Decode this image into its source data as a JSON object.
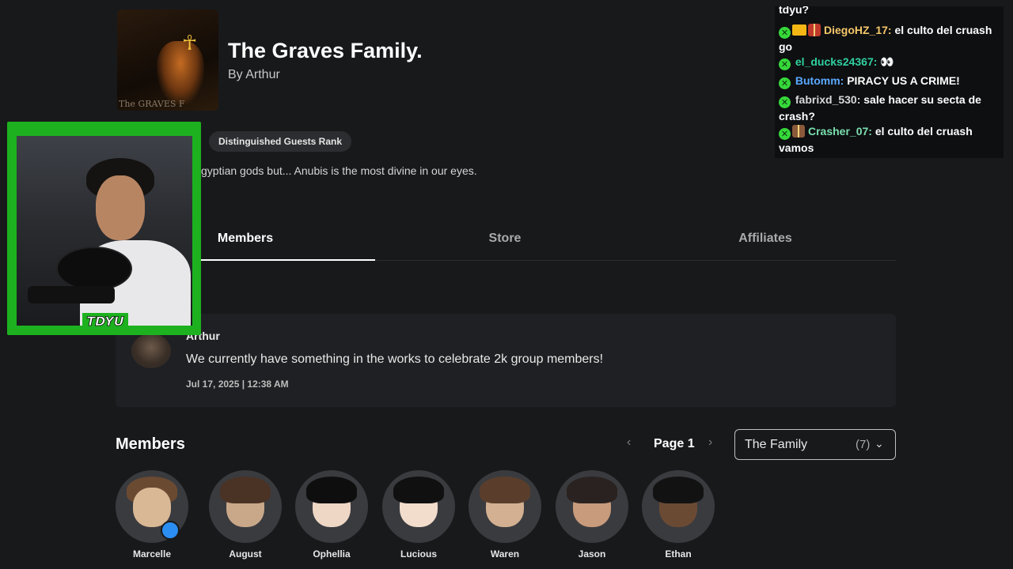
{
  "group": {
    "title": "The Graves Family.",
    "by": "By Arthur",
    "thumb_caption": "The GRAVES F",
    "rank": "Distinguished Guests Rank",
    "description": "gyptian gods but... Anubis is the most divine in our eyes."
  },
  "tabs": [
    {
      "label": "Members",
      "active": true
    },
    {
      "label": "Store",
      "active": false
    },
    {
      "label": "Affiliates",
      "active": false
    }
  ],
  "shout": {
    "author": "Arthur",
    "body": "We currently have something in the works to celebrate 2k group members!",
    "date": "Jul 17, 2025 | 12:38 AM"
  },
  "members": {
    "title": "Members",
    "page_label": "Page 1",
    "prev_icon": "‹",
    "next_icon": "›",
    "role_select": {
      "value": "The Family",
      "count": "(7)",
      "chevron": "⌄"
    },
    "list": [
      {
        "name": "Marcelle"
      },
      {
        "name": "August"
      },
      {
        "name": "Ophellia"
      },
      {
        "name": "Lucious"
      },
      {
        "name": "Waren"
      },
      {
        "name": "Jason"
      },
      {
        "name": "Ethan"
      }
    ]
  },
  "webcam": {
    "tag": "TDYU"
  },
  "chat": {
    "top_fragment": "tdyu?",
    "messages": [
      {
        "user": "DiegoHZ_17:",
        "text": "el culto del cruash go",
        "color": "#f5c86a"
      },
      {
        "user": "el_ducks24367:",
        "text": "👀",
        "color": "#2fd1a0"
      },
      {
        "user": "Butomm:",
        "text": "PIRACY US A CRIME!",
        "color": "#5aa9ff"
      },
      {
        "user": "fabrixd_530:",
        "text": "sale hacer su secta de crash?",
        "color": "#d9d9d9"
      },
      {
        "user": "Crasher_07:",
        "text": "el culto del cruash vamos",
        "color": "#7be0b0"
      }
    ]
  },
  "colors": {
    "background": "#18191b",
    "webcam_border": "#1db11f",
    "chat_badge": "#36d83a"
  }
}
